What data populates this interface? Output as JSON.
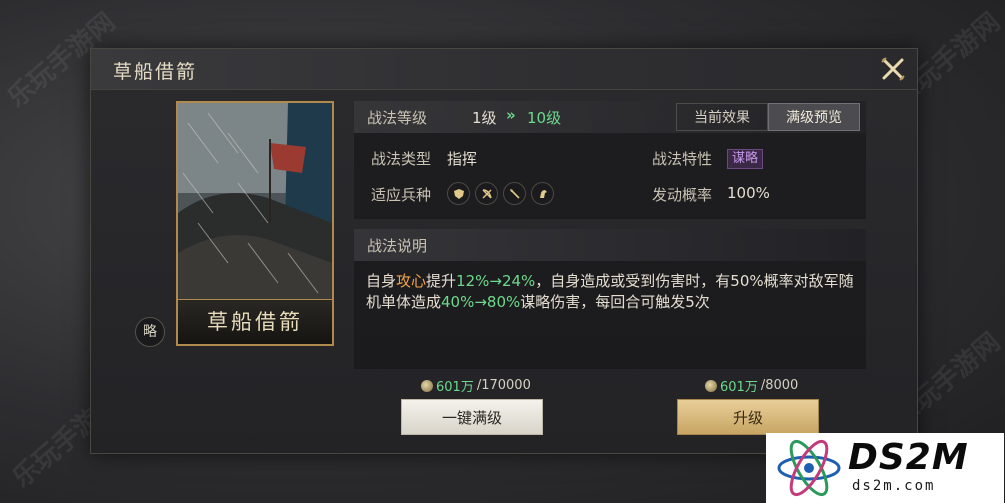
{
  "watermark": {
    "text": "乐玩手游网"
  },
  "panel": {
    "title": "草船借箭"
  },
  "card": {
    "name": "草船借箭",
    "type_badge": "略"
  },
  "info": {
    "level_label": "战法等级",
    "level_from": "1级",
    "level_arrow": "»",
    "level_to": "10级",
    "tabs": [
      {
        "label": "当前效果",
        "active": false
      },
      {
        "label": "满级预览",
        "active": true
      }
    ],
    "type_label": "战法类型",
    "type_value": "指挥",
    "trait_label": "战法特性",
    "trait_value": "谋略",
    "troop_label": "适应兵种",
    "troop_icons": [
      "shield-icon",
      "crossbow-icon",
      "spear-icon",
      "horse-icon"
    ],
    "rate_label": "发动概率",
    "rate_value": "100%"
  },
  "description": {
    "header": "战法说明",
    "p1": "自身",
    "attr": "攻心",
    "p2": "提升",
    "range1": "12%→24%",
    "p3": "，自身造成或受到伤害时，有50%概率对敌军随机单体造成",
    "range2": "40%→80%",
    "p4": "谋略伤害，每回合可触发5次"
  },
  "costs": {
    "left": {
      "amount": "601万",
      "total": "/170000"
    },
    "right": {
      "amount": "601万",
      "total": "/8000"
    }
  },
  "buttons": {
    "max_level": "一键满级",
    "upgrade": "升级"
  },
  "logo": {
    "main": "DS2M",
    "sub": "ds2m.com"
  },
  "colors": {
    "green": "#6dd98c",
    "orange": "#f2a34a",
    "purple": "#c798e8",
    "gold": "#c7a564"
  }
}
